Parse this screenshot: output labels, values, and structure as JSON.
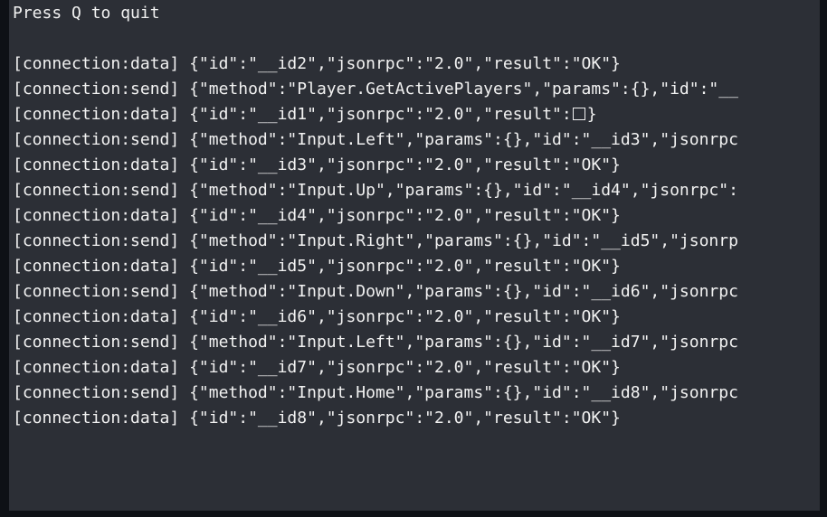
{
  "prompt_line": "Press Q to quit",
  "log_lines": [
    "[connection:data] {\"id\":\"__id2\",\"jsonrpc\":\"2.0\",\"result\":\"OK\"}",
    "[connection:send] {\"method\":\"Player.GetActivePlayers\",\"params\":{},\"id\":\"__",
    "[connection:data] {\"id\":\"__id1\",\"jsonrpc\":\"2.0\",\"result\":",
    "[connection:send] {\"method\":\"Input.Left\",\"params\":{},\"id\":\"__id3\",\"jsonrpc",
    "[connection:data] {\"id\":\"__id3\",\"jsonrpc\":\"2.0\",\"result\":\"OK\"}",
    "[connection:send] {\"method\":\"Input.Up\",\"params\":{},\"id\":\"__id4\",\"jsonrpc\":",
    "[connection:data] {\"id\":\"__id4\",\"jsonrpc\":\"2.0\",\"result\":\"OK\"}",
    "[connection:send] {\"method\":\"Input.Right\",\"params\":{},\"id\":\"__id5\",\"jsonrp",
    "[connection:data] {\"id\":\"__id5\",\"jsonrpc\":\"2.0\",\"result\":\"OK\"}",
    "[connection:send] {\"method\":\"Input.Down\",\"params\":{},\"id\":\"__id6\",\"jsonrpc",
    "[connection:data] {\"id\":\"__id6\",\"jsonrpc\":\"2.0\",\"result\":\"OK\"}",
    "[connection:send] {\"method\":\"Input.Left\",\"params\":{},\"id\":\"__id7\",\"jsonrpc",
    "[connection:data] {\"id\":\"__id7\",\"jsonrpc\":\"2.0\",\"result\":\"OK\"}",
    "[connection:send] {\"method\":\"Input.Home\",\"params\":{},\"id\":\"__id8\",\"jsonrpc",
    "[connection:data] {\"id\":\"__id8\",\"jsonrpc\":\"2.0\",\"result\":\"OK\"}"
  ],
  "line3_suffix": "}",
  "colors": {
    "background": "#2c2f36",
    "text": "#f2f2f2"
  }
}
